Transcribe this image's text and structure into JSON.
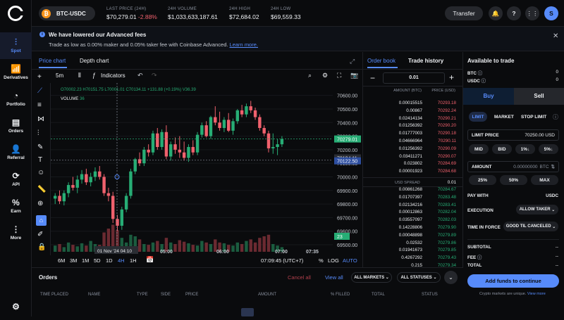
{
  "nav": {
    "items": [
      {
        "label": "Spot",
        "icon": "spot-icon"
      },
      {
        "label": "Derivatives",
        "icon": "derivatives-icon"
      },
      {
        "label": "Portfolio",
        "icon": "portfolio-icon"
      },
      {
        "label": "Orders",
        "icon": "orders-icon"
      },
      {
        "label": "Referral",
        "icon": "referral-icon"
      },
      {
        "label": "API",
        "icon": "api-icon"
      },
      {
        "label": "Earn",
        "icon": "earn-icon"
      },
      {
        "label": "More",
        "icon": "more-icon"
      }
    ]
  },
  "header": {
    "pair": "BTC-USDC",
    "stats": [
      {
        "label": "LAST PRICE (24H)",
        "value": "$70,279.01",
        "change": "-2.88%"
      },
      {
        "label": "24H VOLUME",
        "value": "$1,033,633,187.61"
      },
      {
        "label": "24H HIGH",
        "value": "$72,684.02"
      },
      {
        "label": "24H LOW",
        "value": "$69,559.33"
      }
    ],
    "transfer_label": "Transfer",
    "avatar_initial": "S"
  },
  "banner": {
    "title": "We have lowered our Advanced fees",
    "text": "Trade as low as 0.00% maker and 0.05% taker fee with Coinbase Advanced.",
    "link": "Learn more."
  },
  "chart": {
    "tabs": [
      "Price chart",
      "Depth chart"
    ],
    "interval": "5m",
    "indicators_label": "Indicators",
    "ohlc": {
      "o": "O70002.23",
      "h": "H70151.75",
      "l": "L70001.01",
      "c": "C70134.11",
      "chg": "+131.88 (+0.19%)",
      "v": "V36.39"
    },
    "volume_label": "VOLUME",
    "volume_value": "36",
    "price_ticks": [
      "70600.00",
      "70500.00",
      "70400.00",
      "70300.00",
      "70200.00",
      "70100.00",
      "70000.00",
      "69900.00",
      "69800.00",
      "69700.00",
      "69600.00",
      "69500.00"
    ],
    "price_labels": {
      "last": "70279.01",
      "cross": "70134.11",
      "blue": "70122.50",
      "vol": "23"
    },
    "time_ticks": [
      "05:00",
      "06:00",
      "07:00",
      "07:35"
    ],
    "crosshair_time": "01 Nov '24  04:10",
    "ranges": [
      "6M",
      "3M",
      "1M",
      "5D",
      "1D",
      "4H",
      "1H"
    ],
    "active_range": "4H",
    "clock": "07:09:45 (UTC+7)",
    "scale_buttons": [
      "%",
      "LOG",
      "AUTO"
    ]
  },
  "chart_data": {
    "type": "candlestick",
    "xlabel": "",
    "ylabel": "",
    "ylim": [
      69500,
      70650
    ],
    "candles": [
      [
        69840,
        69880,
        69800,
        69860
      ],
      [
        69860,
        69900,
        69800,
        69820
      ],
      [
        69820,
        69900,
        69790,
        69880
      ],
      [
        69880,
        69960,
        69850,
        69940
      ],
      [
        69940,
        70000,
        69900,
        69920
      ],
      [
        69920,
        70010,
        69880,
        69980
      ],
      [
        69980,
        70050,
        69950,
        70020
      ],
      [
        70020,
        70060,
        69940,
        69960
      ],
      [
        69960,
        70030,
        69930,
        70000
      ],
      [
        70000,
        70070,
        69970,
        70040
      ],
      [
        70040,
        70080,
        69980,
        70000
      ],
      [
        70000,
        70020,
        69860,
        69880
      ],
      [
        69880,
        69920,
        69820,
        69860
      ],
      [
        69860,
        69890,
        69660,
        69690
      ],
      [
        69690,
        69720,
        69600,
        69640
      ],
      [
        69640,
        69780,
        69610,
        69760
      ],
      [
        69760,
        69880,
        69740,
        69860
      ],
      [
        69860,
        70060,
        69840,
        70040
      ],
      [
        70040,
        70140,
        70020,
        70130
      ],
      [
        70130,
        70180,
        70080,
        70100
      ],
      [
        70100,
        70220,
        70080,
        70200
      ],
      [
        70200,
        70240,
        70150,
        70180
      ],
      [
        70180,
        70340,
        70160,
        70320
      ],
      [
        70320,
        70360,
        70200,
        70220
      ],
      [
        70220,
        70350,
        70200,
        70330
      ],
      [
        70330,
        70380,
        70130,
        70150
      ],
      [
        70150,
        70260,
        70120,
        70240
      ],
      [
        70240,
        70290,
        70170,
        70200
      ],
      [
        70200,
        70300,
        70140,
        70180
      ],
      [
        70180,
        70260,
        70120,
        70140
      ],
      [
        70140,
        70240,
        70110,
        70220
      ],
      [
        70220,
        70270,
        70160,
        70180
      ],
      [
        70180,
        70330,
        70160,
        70310
      ],
      [
        70310,
        70400,
        70290,
        70380
      ],
      [
        70380,
        70410,
        70290,
        70300
      ],
      [
        70300,
        70450,
        70280,
        70440
      ],
      [
        70440,
        70520,
        70380,
        70400
      ],
      [
        70400,
        70480,
        70340,
        70360
      ],
      [
        70360,
        70440,
        70330,
        70420
      ],
      [
        70420,
        70470,
        70330,
        70340
      ],
      [
        70340,
        70430,
        70310,
        70410
      ],
      [
        70410,
        70500,
        70390,
        70490
      ],
      [
        70490,
        70530,
        70440,
        70460
      ],
      [
        70460,
        70540,
        70440,
        70520
      ],
      [
        70520,
        70560,
        70470,
        70490
      ],
      [
        70490,
        70510,
        70420,
        70440
      ],
      [
        70440,
        70460,
        70340,
        70360
      ],
      [
        70360,
        70380,
        70300,
        70320
      ],
      [
        70320,
        70340,
        70180,
        70210
      ],
      [
        70210,
        70320,
        70170,
        70220
      ],
      [
        70220,
        70280,
        70160,
        70240
      ],
      [
        70240,
        70300,
        70220,
        70279
      ]
    ],
    "volumes": [
      8,
      10,
      6,
      12,
      9,
      7,
      11,
      8,
      14,
      10,
      9,
      25,
      30,
      35,
      28,
      18,
      12,
      22,
      20,
      16,
      10,
      9,
      12,
      14,
      10,
      18,
      12,
      10,
      15,
      13,
      11,
      9,
      8,
      14,
      12,
      10,
      16,
      12,
      11,
      9,
      8,
      12,
      10,
      14,
      16,
      12,
      18,
      20,
      22,
      10,
      8,
      6
    ]
  },
  "orderbook": {
    "tabs": [
      "Order book",
      "Trade history"
    ],
    "increment": "0.01",
    "headers": [
      "AMOUNT (BTC)",
      "PRICE (USD)"
    ],
    "asks": [
      [
        "0.00015515",
        "70293.18"
      ],
      [
        "0.00867",
        "70292.24"
      ],
      [
        "0.02414134",
        "70290.21"
      ],
      [
        "0.01256392",
        "70290.20"
      ],
      [
        "0.01777003",
        "70290.18"
      ],
      [
        "0.04666964",
        "70290.11"
      ],
      [
        "0.01256392",
        "70290.09"
      ],
      [
        "0.03411271",
        "70290.07"
      ],
      [
        "0.023802",
        "70284.69"
      ],
      [
        "0.00001923",
        "70284.68"
      ]
    ],
    "spread_label": "USD SPREAD",
    "spread_value": "0.01",
    "bids": [
      [
        "0.00861268",
        "70284.67"
      ],
      [
        "0.01707397",
        "70283.48"
      ],
      [
        "0.02134216",
        "70283.41"
      ],
      [
        "0.00012863",
        "70282.04"
      ],
      [
        "0.03557097",
        "70282.03"
      ],
      [
        "0.14228806",
        "70279.90"
      ],
      [
        "0.00048898",
        "70279.89"
      ],
      [
        "0.02532",
        "70279.86"
      ],
      [
        "0.01941673",
        "70279.85"
      ],
      [
        "0.4267292",
        "70279.43"
      ],
      [
        "0.215",
        "70279.34"
      ]
    ]
  },
  "trade": {
    "title": "Available to trade",
    "balances": [
      {
        "label": "BTC",
        "value": "0"
      },
      {
        "label": "USDC",
        "value": "0"
      }
    ],
    "buy": "Buy",
    "sell": "Sell",
    "order_types": [
      "LIMIT",
      "MARKET",
      "STOP LIMIT"
    ],
    "limit_price_label": "LIMIT PRICE",
    "limit_price_value": "70250.00 USD",
    "price_buttons": [
      "MID",
      "BID",
      "1%↓",
      "5%↓"
    ],
    "amount_label": "AMOUNT",
    "amount_value": "0.00000000",
    "amount_unit": "BTC",
    "pct_buttons": [
      "25%",
      "50%",
      "MAX"
    ],
    "pay_with_label": "PAY WITH",
    "pay_with_value": "USDC",
    "execution_label": "EXECUTION",
    "execution_value": "ALLOW TAKER",
    "tif_label": "TIME IN FORCE",
    "tif_value": "GOOD TIL CANCELED",
    "subtotal_label": "SUBTOTAL",
    "subtotal_value": "--",
    "fee_label": "FEE",
    "fee_value": "--",
    "total_label": "TOTAL",
    "total_value": "--",
    "cta": "Add funds to continue",
    "footnote": "Crypto markets are unique.",
    "footnote_link": "View more"
  },
  "orders": {
    "title": "Orders",
    "cancel_all": "Cancel all",
    "view_all": "View all",
    "markets_filter": "ALL MARKETS",
    "status_filter": "ALL STATUSES",
    "columns": [
      "TIME PLACED",
      "NAME",
      "TYPE",
      "SIDE",
      "PRICE",
      "AMOUNT",
      "% FILLED",
      "TOTAL",
      "STATUS"
    ]
  },
  "colors": {
    "accent": "#578bfa",
    "up": "#27ad75",
    "down": "#f0616d",
    "bg": "#0a0b0d"
  }
}
